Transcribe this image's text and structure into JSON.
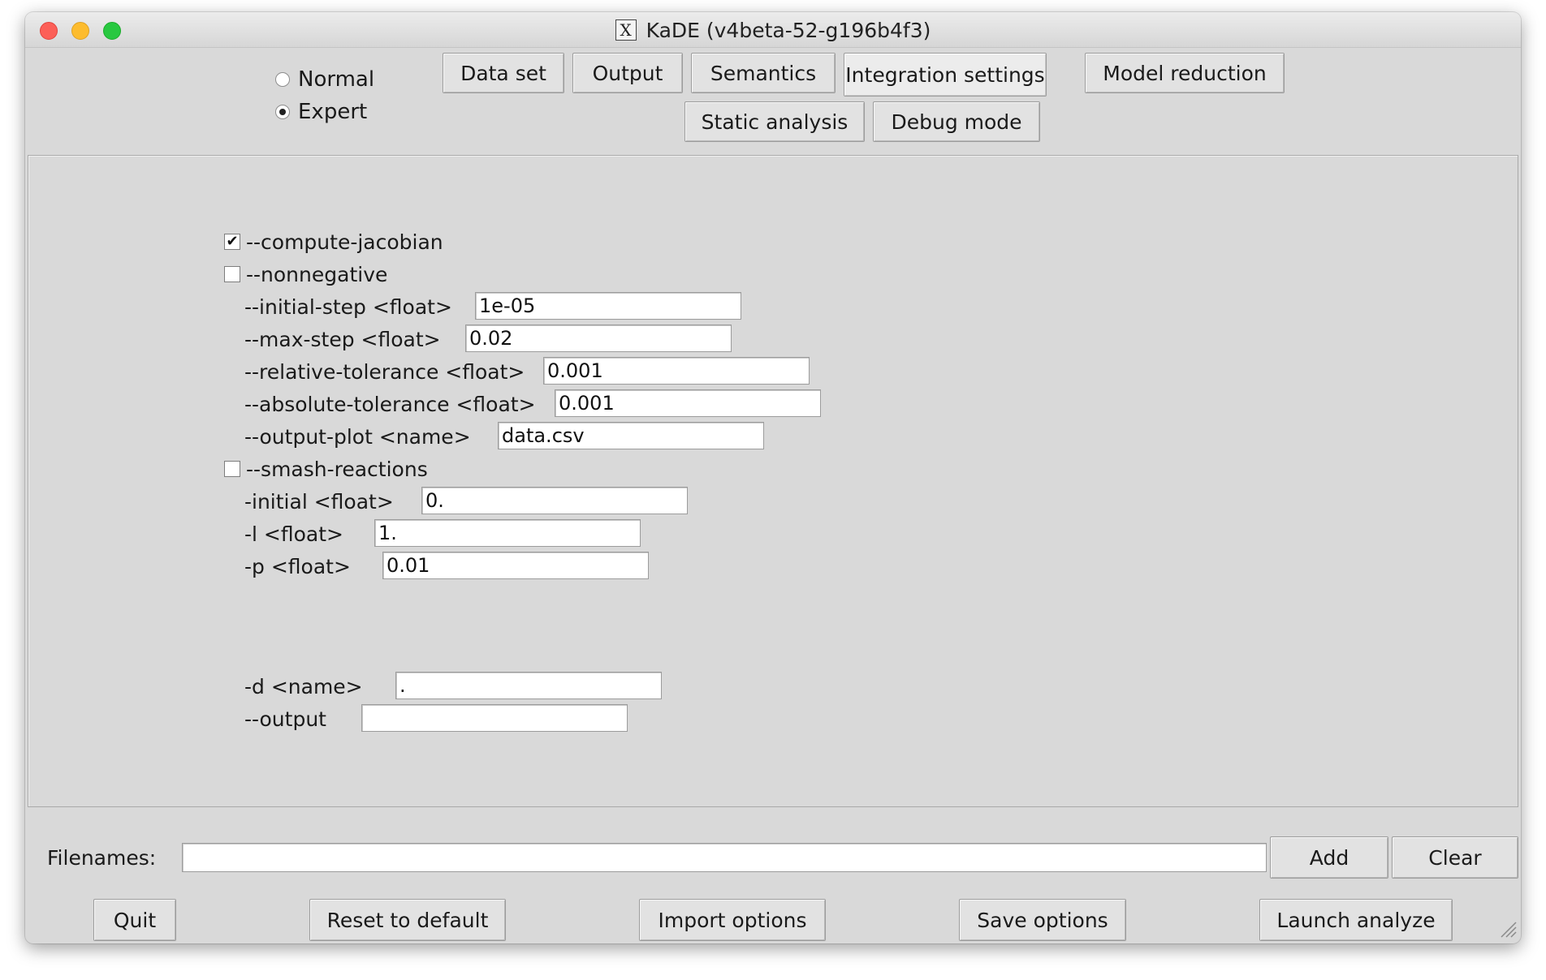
{
  "window": {
    "title": "KaDE (v4beta-52-g196b4f3)"
  },
  "mode": {
    "options": [
      {
        "label": "Normal",
        "selected": false
      },
      {
        "label": "Expert",
        "selected": true
      }
    ]
  },
  "tabs": {
    "data_set": "Data set",
    "output": "Output",
    "semantics": "Semantics",
    "integration_settings": "Integration settings",
    "model_reduction": "Model reduction",
    "static_analysis": "Static analysis",
    "debug_mode": "Debug mode",
    "active": "Integration settings"
  },
  "settings": {
    "compute_jacobian": {
      "label": "--compute-jacobian",
      "checked": true,
      "mark": "✔"
    },
    "nonnegative": {
      "label": "--nonnegative",
      "checked": false
    },
    "initial_step": {
      "label": "--initial-step <float>",
      "value": "1e-05"
    },
    "max_step": {
      "label": "--max-step <float>",
      "value": "0.02"
    },
    "relative_tolerance": {
      "label": "--relative-tolerance <float>",
      "value": "0.001"
    },
    "absolute_tolerance": {
      "label": "--absolute-tolerance <float>",
      "value": "0.001"
    },
    "output_plot": {
      "label": "--output-plot <name>",
      "value": "data.csv"
    },
    "smash_reactions": {
      "label": "--smash-reactions",
      "checked": false
    },
    "initial": {
      "label": "-initial <float>",
      "value": "0."
    },
    "l": {
      "label": "-l <float>",
      "value": "1."
    },
    "p": {
      "label": "-p <float>",
      "value": "0.01"
    },
    "d": {
      "label": "-d <name>",
      "value": "."
    },
    "output": {
      "label": "--output",
      "value": ""
    }
  },
  "filenames": {
    "label": "Filenames:",
    "value": "",
    "add": "Add",
    "clear": "Clear"
  },
  "footer": {
    "quit": "Quit",
    "reset": "Reset to default",
    "import": "Import options",
    "save": "Save options",
    "launch": "Launch analyze"
  }
}
